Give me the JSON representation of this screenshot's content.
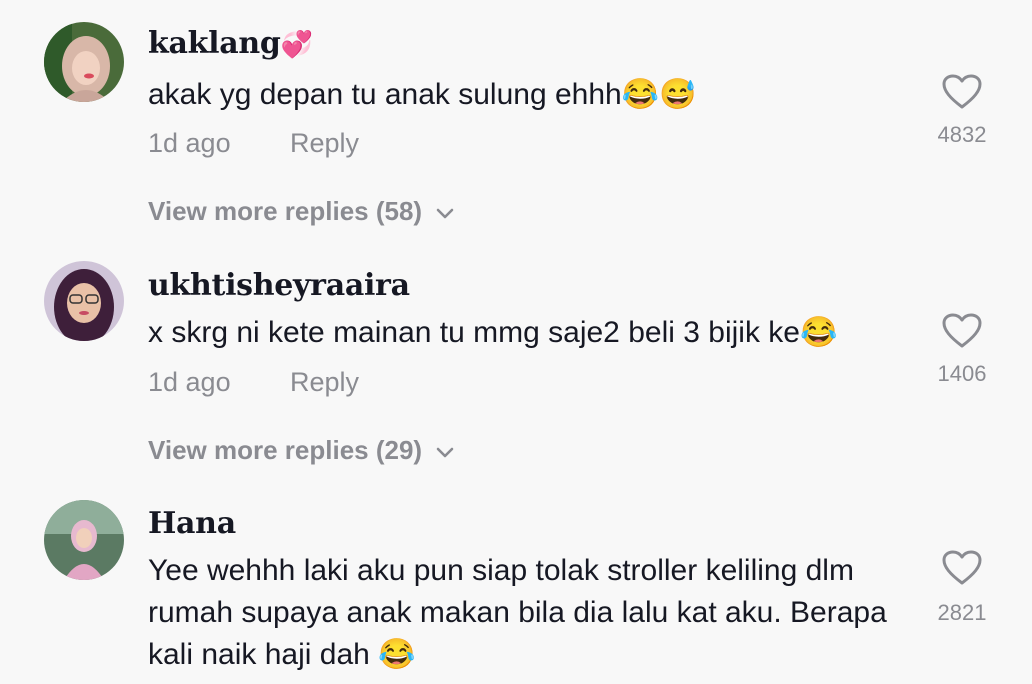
{
  "comments": [
    {
      "username": "kaklang",
      "username_emoji": "💞",
      "text": "akak yg depan tu anak sulung ehhh😂😅",
      "time": "1d ago",
      "reply_label": "Reply",
      "likes": "4832",
      "view_more": "View more replies (58)"
    },
    {
      "username": "ukhtisheyraaira",
      "text": "x skrg ni kete mainan tu mmg saje2 beli 3 bijik ke😂",
      "time": "1d ago",
      "reply_label": "Reply",
      "likes": "1406",
      "view_more": "View more replies (29)"
    },
    {
      "username": "Hana",
      "text": "Yee wehhh laki aku pun siap tolak stroller keliling dlm rumah supaya anak makan bila dia lalu kat aku. Berapa kali naik haji dah 😂",
      "likes": "2821"
    }
  ],
  "colors": {
    "background": "#f8f8f8",
    "text": "#161823",
    "secondary": "#8a8b91"
  }
}
